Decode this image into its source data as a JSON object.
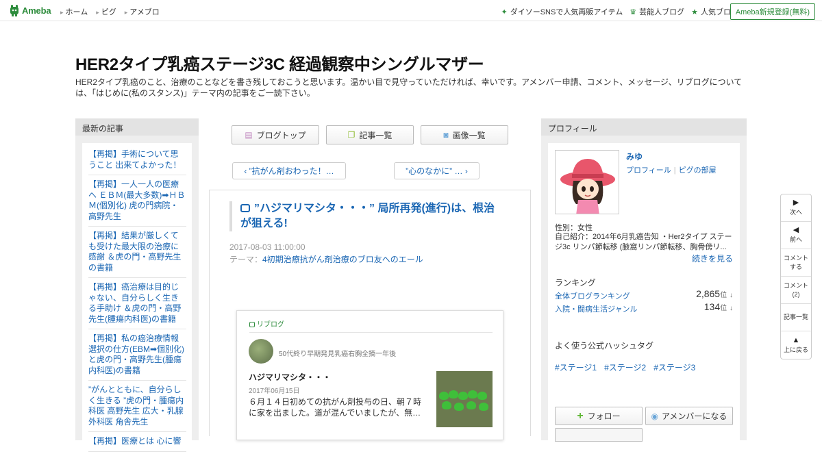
{
  "topbar": {
    "logo_text": "Ameba",
    "nav": [
      "ホーム",
      "ピグ",
      "アメブロ"
    ],
    "right_links": [
      {
        "label": "ダイソーSNSで人気再販アイテム",
        "icon": "sparkle-icon"
      },
      {
        "label": "芸能人ブログ",
        "icon": "crown-icon"
      },
      {
        "label": "人気ブログ",
        "icon": "star-icon"
      }
    ],
    "signup_label": "Ameba新規登録(無料)",
    "accent": "#2d8c3c"
  },
  "header": {
    "title": "HER2タイプ乳癌ステージ3C 経過観察中シングルマザー",
    "description": "HER2タイプ乳癌のこと、治療のことなどを書き残しておこうと思います。温かい目で見守っていただければ、幸いです。アメンバー申請、コメント、メッセージ、リブログについては、「はじめに(私のスタンス)」テーマ内の記事をご一読下さい。"
  },
  "recent": {
    "heading": "最新の記事",
    "items": [
      "【再掲】手術について思うこと 出来てよかった！",
      "【再掲】一人一人の医療へ ＥＢＭ(最大多数)➡ＨＢＭ(個別化) 虎の門病院・高野先生",
      "【再掲】結果が厳しくても受けた最大限の治療に感謝 ＆虎の門・高野先生の書籍",
      "【再掲】癌治療は目的じゃない、自分らしく生きる手助け ＆虎の門・高野先生(腫瘍内科医)の書籍",
      "【再掲】私の癌治療情報選択の仕方(EBM➡個別化)と虎の門・高野先生(腫瘍内科医)の書籍",
      "”がんとともに、自分らしく生きる ”虎の門・腫瘍内科医 高野先生 広大・乳腺外科医 角舎先生",
      "【再掲】医療とは 心に響"
    ]
  },
  "tabs": [
    {
      "label": "ブログトップ",
      "icon": "document-icon"
    },
    {
      "label": "記事一覧",
      "icon": "list-icon"
    },
    {
      "label": "画像一覧",
      "icon": "camera-icon"
    }
  ],
  "pager": {
    "prev": "‹ ”抗がん剤おわった！…",
    "next": "”心のなかに” … ›"
  },
  "article": {
    "title": "”ハジマリマシタ・・・” 局所再発(進行)は、根治が狙える!",
    "date": "2017-08-03 11:00:00",
    "theme_prefix": "テーマ：",
    "theme": "4初期治療抗がん剤治療のブロ友へのエール"
  },
  "reblog": {
    "label": "リブログ",
    "owner": "50代終り早期発見乳癌右胸全摘一年後",
    "title": "ハジマリマシタ・・・",
    "date": "2017年06月15日",
    "excerpt": "６月１４日初めての抗がん剤投与の日、朝７時に家を出ました。道が混んでいましたが、無…"
  },
  "profile": {
    "heading": "プロフィール",
    "name": "みゆ",
    "link_profile": "プロフィール",
    "link_pig": "ピグの部屋",
    "gender": "性別：女性",
    "intro": "自己紹介：2014年6月乳癌告知 ・Her2タイプ ステージ3c リンパ節転移 (腋窩リンパ節転移、胸骨傍リ...",
    "more": "続きを見る",
    "ranking_heading": "ランキング",
    "rankings": [
      {
        "label": "全体ブログランキング",
        "value": "2,865",
        "unit": "位",
        "trend": "↓"
      },
      {
        "label": "入院・闘病生活ジャンル",
        "value": "134",
        "unit": "位",
        "trend": "↓"
      }
    ],
    "tags_heading": "よく使う公式ハッシュタグ",
    "tags": [
      "#ステージ1",
      "#ステージ2",
      "#ステージ3"
    ],
    "follow_label": "フォロー",
    "amember_label": "アメンバーになる"
  },
  "sidenav": [
    {
      "label": "次へ",
      "icon": "triangle-right-icon",
      "glyph": "▶"
    },
    {
      "label": "前へ",
      "icon": "triangle-left-icon",
      "glyph": "◀"
    },
    {
      "label": "コメントする",
      "icon": "",
      "glyph": ""
    },
    {
      "label": "コメント(2)",
      "icon": "",
      "glyph": ""
    },
    {
      "label": "記事一覧",
      "icon": "",
      "glyph": ""
    },
    {
      "label": "上に戻る",
      "icon": "triangle-up-icon",
      "glyph": "▲"
    }
  ]
}
